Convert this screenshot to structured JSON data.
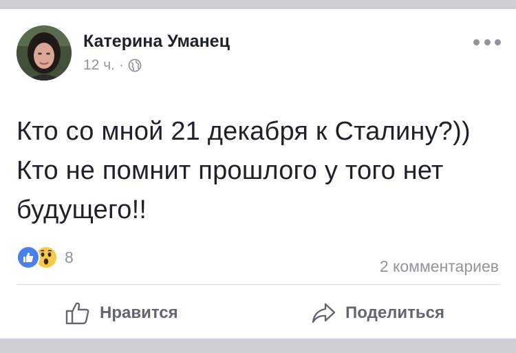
{
  "post": {
    "author": "Катерина Уманец",
    "time": "12 ч.",
    "separator": "·",
    "text": "Кто со мной 21 декабря к Сталину?)) Кто не помнит прошлого у того нет будущего!!",
    "reactions": {
      "types": [
        "like-icon",
        "wow-icon"
      ],
      "count": "8"
    },
    "comments": "2 комментариев"
  },
  "actions": {
    "like_label": "Нравится",
    "share_label": "Поделиться"
  },
  "colors": {
    "text": "#1d2129",
    "muted": "#90949c",
    "like_blue": "#4a7ff0",
    "wow_yellow": "#f7c94a",
    "frame": "#ccd0d5"
  }
}
